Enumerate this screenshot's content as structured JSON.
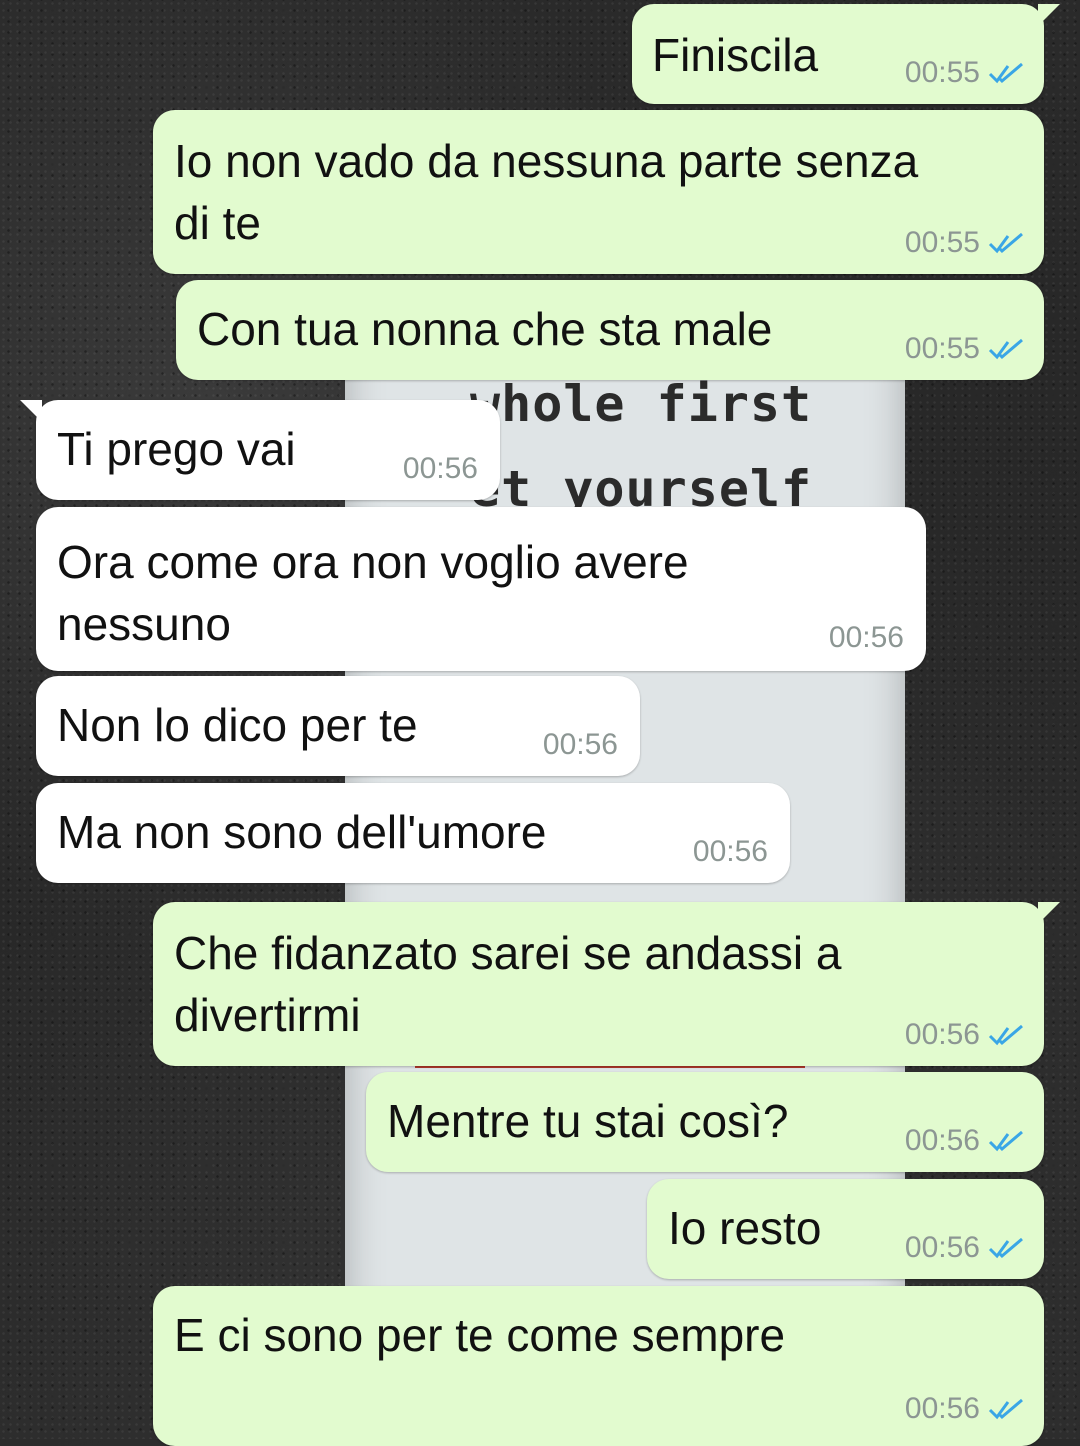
{
  "background": {
    "poster_lines": [
      "whole first",
      "et yourself"
    ]
  },
  "colors": {
    "outgoing_bubble": "#e2fbcf",
    "incoming_bubble": "#ffffff",
    "read_ticks": "#3aa6e6",
    "timestamp": "#8c9693"
  },
  "messages": [
    {
      "direction": "out",
      "text_lines": [
        "Finiscila"
      ],
      "time": "00:55",
      "status": "read-double-check-icon"
    },
    {
      "direction": "out",
      "text_lines": [
        "Io non vado da nessuna parte senza",
        "di te"
      ],
      "time": "00:55",
      "status": "read-double-check-icon"
    },
    {
      "direction": "out",
      "text_lines": [
        "Con tua nonna che sta male"
      ],
      "time": "00:55",
      "status": "read-double-check-icon"
    },
    {
      "direction": "in",
      "text_lines": [
        "Ti prego vai"
      ],
      "time": "00:56"
    },
    {
      "direction": "in",
      "text_lines": [
        "Ora come ora non voglio avere",
        "nessuno"
      ],
      "time": "00:56"
    },
    {
      "direction": "in",
      "text_lines": [
        "Non lo dico per te"
      ],
      "time": "00:56"
    },
    {
      "direction": "in",
      "text_lines": [
        "Ma non sono dell'umore"
      ],
      "time": "00:56"
    },
    {
      "direction": "out",
      "text_lines": [
        "Che fidanzato sarei se andassi a",
        "divertirmi"
      ],
      "time": "00:56",
      "status": "read-double-check-icon"
    },
    {
      "direction": "out",
      "text_lines": [
        "Mentre tu stai così?"
      ],
      "time": "00:56",
      "status": "read-double-check-icon"
    },
    {
      "direction": "out",
      "text_lines": [
        "Io resto"
      ],
      "time": "00:56",
      "status": "read-double-check-icon"
    },
    {
      "direction": "out",
      "text_lines": [
        "E ci sono per te come sempre"
      ],
      "time": "00:56",
      "status": "read-double-check-icon"
    }
  ]
}
